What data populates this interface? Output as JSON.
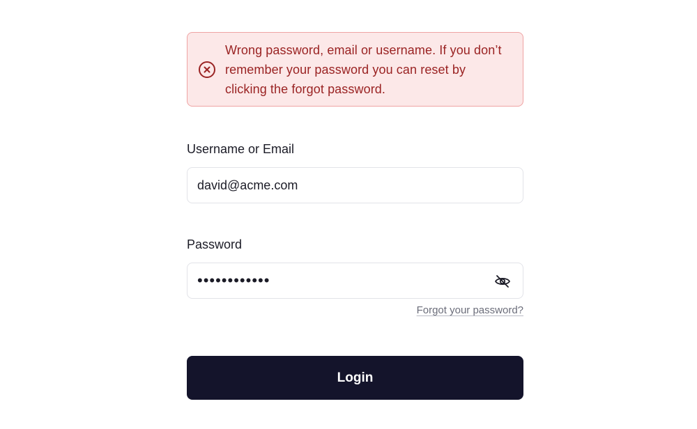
{
  "alert": {
    "icon": "error-circle-icon",
    "message": "Wrong password, email or username. If you don’t remember your password you can reset by clicking the forgot password.",
    "color": "#9a2323",
    "background": "#fce8e8"
  },
  "username": {
    "label": "Username or Email",
    "value": "david@acme.com"
  },
  "password": {
    "label": "Password",
    "value": "••••••••••••",
    "toggle_icon": "eye-off-icon"
  },
  "forgot": {
    "label": "Forgot your password?"
  },
  "login": {
    "label": "Login",
    "background": "#14142b"
  }
}
